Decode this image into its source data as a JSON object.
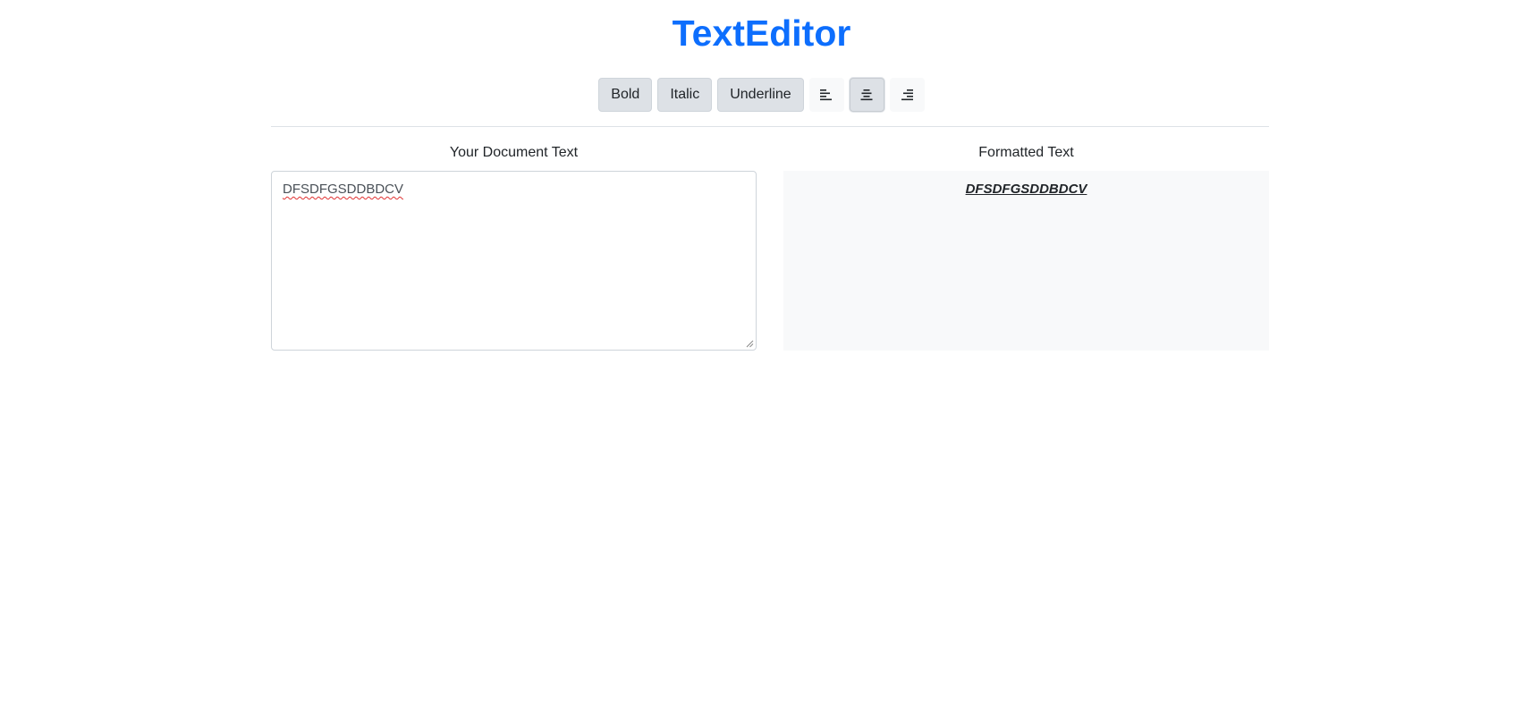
{
  "app": {
    "title": "TextEditor",
    "accent_color": "#0d6efd"
  },
  "toolbar": {
    "bold_label": "Bold",
    "italic_label": "Italic",
    "underline_label": "Underline",
    "align_left_icon": "align-left-icon",
    "align_center_icon": "align-center-icon",
    "align_right_icon": "align-right-icon",
    "active_alignment": "center"
  },
  "editor": {
    "label": "Your Document Text",
    "value": "DFSDFGSDDBDCV"
  },
  "preview": {
    "label": "Formatted Text",
    "text": "DFSDFGSDDBDCV",
    "bold": true,
    "italic": true,
    "underline": true,
    "alignment": "center"
  }
}
